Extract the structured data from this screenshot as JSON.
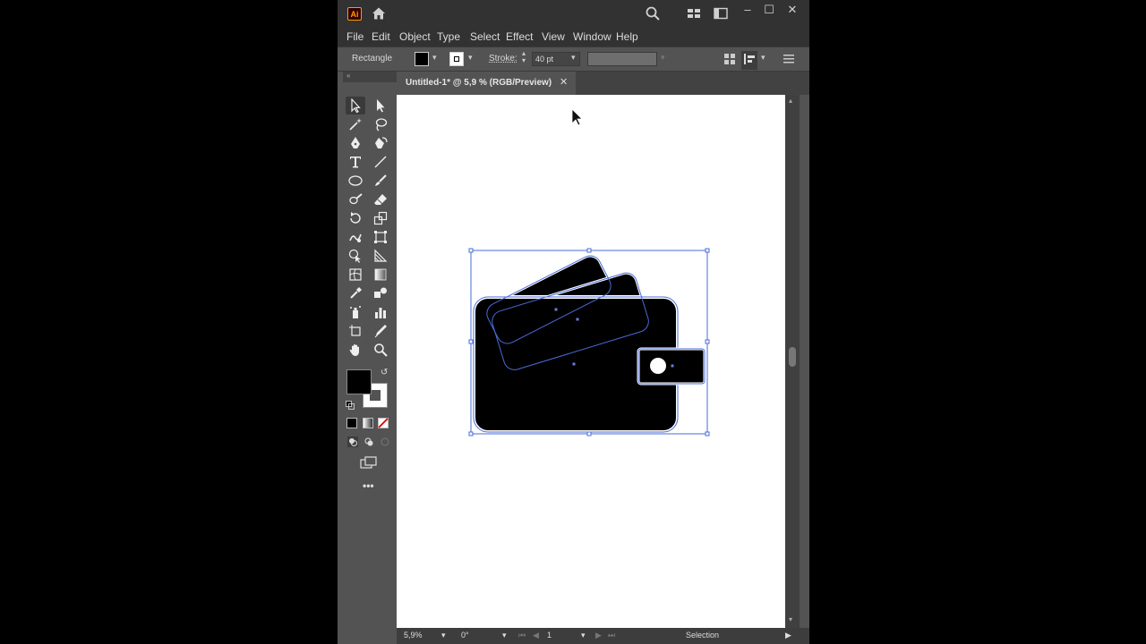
{
  "app": {
    "logo": "Ai"
  },
  "menu": [
    "File",
    "Edit",
    "Object",
    "Type",
    "Select",
    "Effect",
    "View",
    "Window",
    "Help"
  ],
  "control_bar": {
    "object_type": "Rectangle",
    "stroke_label": "Stroke:",
    "stroke_value": "40 pt"
  },
  "document": {
    "tab_title": "Untitled-1* @ 5,9 % (RGB/Preview)",
    "close_glyph": "✕"
  },
  "status": {
    "zoom": "5,9%",
    "rotation": "0°",
    "artboard": "1",
    "tool": "Selection"
  },
  "colors": {
    "fill": "#000000",
    "stroke": "#ffffff",
    "selection": "#4a6bd8",
    "accent": "#ff9a00"
  },
  "icons": [
    "home-icon",
    "search-icon",
    "arrange-documents-icon",
    "workspace-icon",
    "minimize-icon",
    "maximize-icon",
    "close-icon"
  ]
}
